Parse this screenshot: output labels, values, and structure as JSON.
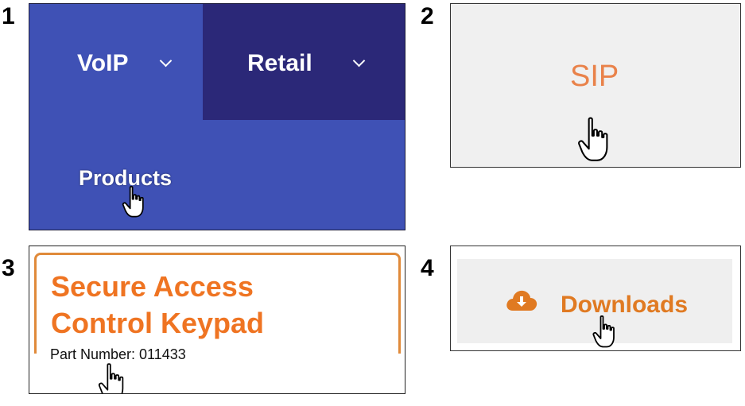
{
  "steps": [
    "1",
    "2",
    "3",
    "4"
  ],
  "panel1": {
    "menu_items": [
      {
        "label": "VoIP"
      },
      {
        "label": "Retail"
      }
    ],
    "products_label": "Products",
    "colors": {
      "voip_bg": "#3f51b5",
      "retail_bg": "#2b2878"
    }
  },
  "panel2": {
    "sip_label": "SIP",
    "color": "#e9824a"
  },
  "panel3": {
    "title_line1": "Secure Access",
    "title_line2": "Control Keypad",
    "part_number": "Part Number: 011433",
    "accent": "#ef7422"
  },
  "panel4": {
    "downloads_label": "Downloads",
    "icon": "cloud-download-icon",
    "accent": "#e07a22"
  },
  "cursor_icon": "hand-pointer-icon"
}
